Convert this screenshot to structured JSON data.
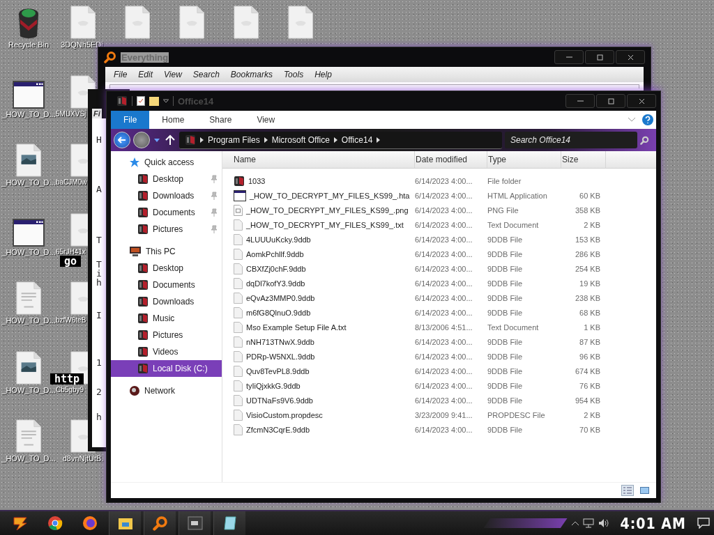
{
  "desktop": {
    "icons": [
      {
        "label": "Recycle Bin",
        "kind": "recycle"
      },
      {
        "label": "_HOW_TO_D...",
        "kind": "hta"
      },
      {
        "label": "_HOW_TO_D...",
        "kind": "png"
      },
      {
        "label": "_HOW_TO_D...",
        "kind": "hta"
      },
      {
        "label": "_HOW_TO_D...",
        "kind": "txt"
      },
      {
        "label": "_HOW_TO_D...",
        "kind": "png"
      },
      {
        "label": "_HOW_TO_D...",
        "kind": "txt"
      },
      {
        "label": "3DQNh5EDj.",
        "kind": "blank"
      },
      {
        "label": "5MUXVSj",
        "kind": "blank"
      },
      {
        "label": "baCJM0w",
        "kind": "blank"
      },
      {
        "label": "65rJH41x",
        "kind": "blank"
      },
      {
        "label": "bzfW6teB",
        "kind": "blank"
      },
      {
        "label": "Cb5gby9",
        "kind": "blank"
      },
      {
        "label": "d8vnNjtUtB.",
        "kind": "blank"
      },
      {
        "kind": "blank"
      },
      {
        "kind": "blank"
      },
      {
        "kind": "blank"
      },
      {
        "kind": "blank"
      }
    ],
    "overlays": [
      "go",
      "http"
    ]
  },
  "everything_window": {
    "title": "Everything",
    "menu": [
      "File",
      "Edit",
      "View",
      "Search",
      "Bookmarks",
      "Tools",
      "Help"
    ]
  },
  "back_window": {
    "menu": "Fi",
    "lines": [
      "H",
      "A",
      "T",
      "T",
      "i",
      "h",
      "I",
      "1",
      "2",
      "h"
    ]
  },
  "explorer": {
    "title": "Office14",
    "ribbon_tabs": [
      {
        "label": "File",
        "selected": true
      },
      {
        "label": "Home",
        "selected": false
      },
      {
        "label": "Share",
        "selected": false
      },
      {
        "label": "View",
        "selected": false
      }
    ],
    "breadcrumb": [
      "Program Files",
      "Microsoft Office",
      "Office14"
    ],
    "search": {
      "placeholder": "Search Office14"
    },
    "navigation": [
      {
        "label": "Quick access",
        "kind": "quick",
        "selected": false,
        "children": [
          {
            "label": "Desktop",
            "pinned": true,
            "selected": false
          },
          {
            "label": "Downloads",
            "pinned": true,
            "selected": false
          },
          {
            "label": "Documents",
            "pinned": true,
            "selected": false
          },
          {
            "label": "Pictures",
            "pinned": true,
            "selected": false
          }
        ]
      },
      {
        "label": "This PC",
        "kind": "pc",
        "selected": false,
        "children": [
          {
            "label": "Desktop",
            "pinned": false,
            "selected": false
          },
          {
            "label": "Documents",
            "pinned": false,
            "selected": false
          },
          {
            "label": "Downloads",
            "pinned": false,
            "selected": false
          },
          {
            "label": "Music",
            "pinned": false,
            "selected": false
          },
          {
            "label": "Pictures",
            "pinned": false,
            "selected": false
          },
          {
            "label": "Videos",
            "pinned": false,
            "selected": false
          },
          {
            "label": "Local Disk (C:)",
            "pinned": false,
            "selected": true
          }
        ]
      },
      {
        "label": "Network",
        "kind": "network",
        "selected": false
      }
    ],
    "columns": [
      "Name",
      "Date modified",
      "Type",
      "Size"
    ],
    "files": [
      {
        "name": "1033",
        "date": "6/14/2023 4:00...",
        "type": "File folder",
        "kind": "folder"
      },
      {
        "name": "_HOW_TO_DECRYPT_MY_FILES_KS99_.hta",
        "date": "6/14/2023 4:00...",
        "type": "HTML Application",
        "size": "60 KB",
        "kind": "hta"
      },
      {
        "name": "_HOW_TO_DECRYPT_MY_FILES_KS99_.png",
        "date": "6/14/2023 4:00...",
        "type": "PNG File",
        "size": "358 KB",
        "kind": "png"
      },
      {
        "name": "_HOW_TO_DECRYPT_MY_FILES_KS99_.txt",
        "date": "6/14/2023 4:00...",
        "type": "Text Document",
        "size": "2 KB",
        "kind": "file"
      },
      {
        "name": "4LUUUuKcky.9ddb",
        "date": "6/14/2023 4:00...",
        "type": "9DDB File",
        "size": "153 KB",
        "kind": "file"
      },
      {
        "name": "AomkPchllf.9ddb",
        "date": "6/14/2023 4:00...",
        "type": "9DDB File",
        "size": "286 KB",
        "kind": "file"
      },
      {
        "name": "CBXfZj0chF.9ddb",
        "date": "6/14/2023 4:00...",
        "type": "9DDB File",
        "size": "254 KB",
        "kind": "file"
      },
      {
        "name": "dqDl7kofY3.9ddb",
        "date": "6/14/2023 4:00...",
        "type": "9DDB File",
        "size": "19 KB",
        "kind": "file"
      },
      {
        "name": "eQvAz3MMP0.9ddb",
        "date": "6/14/2023 4:00...",
        "type": "9DDB File",
        "size": "238 KB",
        "kind": "file"
      },
      {
        "name": "m6fG8QlnuO.9ddb",
        "date": "6/14/2023 4:00...",
        "type": "9DDB File",
        "size": "68 KB",
        "kind": "file"
      },
      {
        "name": "Mso Example Setup File A.txt",
        "date": "8/13/2006 4:51...",
        "type": "Text Document",
        "size": "1 KB",
        "kind": "file"
      },
      {
        "name": "nNH713TNwX.9ddb",
        "date": "6/14/2023 4:00...",
        "type": "9DDB File",
        "size": "87 KB",
        "kind": "file"
      },
      {
        "name": "PDRp-W5NXL.9ddb",
        "date": "6/14/2023 4:00...",
        "type": "9DDB File",
        "size": "96 KB",
        "kind": "file"
      },
      {
        "name": "Quv8TevPL8.9ddb",
        "date": "6/14/2023 4:00...",
        "type": "9DDB File",
        "size": "674 KB",
        "kind": "file"
      },
      {
        "name": "tyIiQjxkkG.9ddb",
        "date": "6/14/2023 4:00...",
        "type": "9DDB File",
        "size": "76 KB",
        "kind": "file"
      },
      {
        "name": "UDTNaFs9V6.9ddb",
        "date": "6/14/2023 4:00...",
        "type": "9DDB File",
        "size": "954 KB",
        "kind": "file"
      },
      {
        "name": "VisioCustom.propdesc",
        "date": "3/23/2009 9:41...",
        "type": "PROPDESC File",
        "size": "2 KB",
        "kind": "file"
      },
      {
        "name": "ZfcmN3CqrE.9ddb",
        "date": "6/14/2023 4:00...",
        "type": "9DDB File",
        "size": "70 KB",
        "kind": "file"
      }
    ]
  },
  "taskbar": {
    "clock": "4:01 AM"
  }
}
